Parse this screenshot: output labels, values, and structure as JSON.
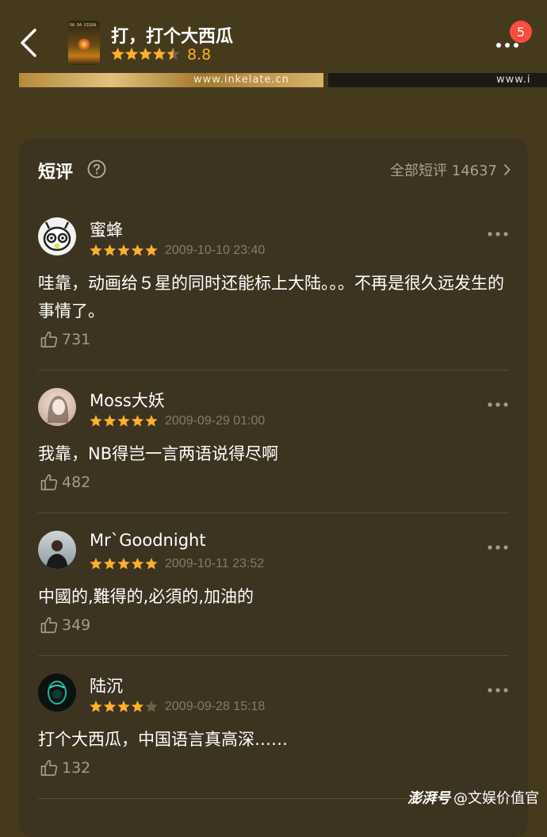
{
  "header": {
    "title": "打，打个大西瓜",
    "rating_stars": 4.5,
    "score": "8.8",
    "badge_count": "5",
    "poster_text": "打，打个大西瓜"
  },
  "strip": {
    "watermark_left": "www.inkelate.cn",
    "watermark_right": "www.i"
  },
  "short_reviews": {
    "title": "短评",
    "all_label": "全部短评 14637"
  },
  "reviews": [
    {
      "user": "蜜蜂",
      "stars": 5,
      "date": "2009-10-10 23:40",
      "text": "哇靠，动画给５星的同时还能标上大陆。。。不再是很久远发生的事情了。",
      "likes": "731"
    },
    {
      "user": "Moss大妖",
      "stars": 5,
      "date": "2009-09-29 01:00",
      "text": "我靠，NB得岂一言两语说得尽啊",
      "likes": "482"
    },
    {
      "user": "Mr`Goodnight",
      "stars": 5,
      "date": "2009-10-11 23:52",
      "text": "中國的,難得的,必須的,加油的",
      "likes": "349"
    },
    {
      "user": "陆沉",
      "stars": 4,
      "date": "2009-09-28 15:18",
      "text": "打个大西瓜，中国语言真高深……",
      "likes": "132"
    }
  ],
  "footer": {
    "logo": "澎湃号",
    "account": "@文娱价值官"
  },
  "colors": {
    "background": "#463a1d",
    "card": "#3d3321",
    "star": "#ffb027",
    "badge": "#ff4b3e"
  }
}
